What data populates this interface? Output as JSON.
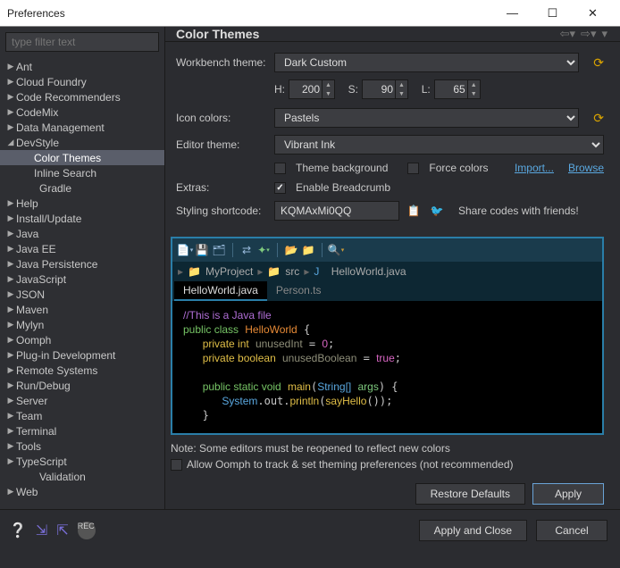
{
  "window": {
    "title": "Preferences"
  },
  "filter": {
    "placeholder": "type filter text"
  },
  "tree": [
    {
      "label": "Ant",
      "caret": "▶"
    },
    {
      "label": "Cloud Foundry",
      "caret": "▶"
    },
    {
      "label": "Code Recommenders",
      "caret": "▶"
    },
    {
      "label": "CodeMix",
      "caret": "▶"
    },
    {
      "label": "Data Management",
      "caret": "▶"
    },
    {
      "label": "DevStyle",
      "caret": "◢",
      "expanded": true,
      "children": [
        {
          "label": "Color Themes",
          "selected": true
        },
        {
          "label": "Inline Search"
        }
      ]
    },
    {
      "label": "Gradle",
      "caret": ""
    },
    {
      "label": "Help",
      "caret": "▶"
    },
    {
      "label": "Install/Update",
      "caret": "▶"
    },
    {
      "label": "Java",
      "caret": "▶"
    },
    {
      "label": "Java EE",
      "caret": "▶"
    },
    {
      "label": "Java Persistence",
      "caret": "▶"
    },
    {
      "label": "JavaScript",
      "caret": "▶"
    },
    {
      "label": "JSON",
      "caret": "▶"
    },
    {
      "label": "Maven",
      "caret": "▶"
    },
    {
      "label": "Mylyn",
      "caret": "▶"
    },
    {
      "label": "Oomph",
      "caret": "▶"
    },
    {
      "label": "Plug-in Development",
      "caret": "▶"
    },
    {
      "label": "Remote Systems",
      "caret": "▶"
    },
    {
      "label": "Run/Debug",
      "caret": "▶"
    },
    {
      "label": "Server",
      "caret": "▶"
    },
    {
      "label": "Team",
      "caret": "▶"
    },
    {
      "label": "Terminal",
      "caret": "▶"
    },
    {
      "label": "Tools",
      "caret": "▶"
    },
    {
      "label": "TypeScript",
      "caret": "▶"
    },
    {
      "label": "Validation",
      "caret": ""
    },
    {
      "label": "Web",
      "caret": "▶"
    }
  ],
  "header": {
    "title": "Color Themes"
  },
  "form": {
    "workbench_label": "Workbench theme:",
    "workbench_value": "Dark Custom",
    "hsl": {
      "h_label": "H:",
      "h": "200",
      "s_label": "S:",
      "s": "90",
      "l_label": "L:",
      "l": "65"
    },
    "icon_label": "Icon colors:",
    "icon_value": "Pastels",
    "editor_label": "Editor theme:",
    "editor_value": "Vibrant Ink",
    "theme_bg": "Theme background",
    "force_colors": "Force colors",
    "import": "Import...",
    "browse": "Browse",
    "extras_label": "Extras:",
    "enable_breadcrumb": "Enable Breadcrumb",
    "shortcode_label": "Styling shortcode:",
    "shortcode_value": "KQMAxMi0QQ",
    "share_text": "Share codes with friends!"
  },
  "preview": {
    "breadcrumb": {
      "project": "MyProject",
      "src": "src",
      "jkind": "J",
      "file": "HelloWorld.java"
    },
    "tabs": [
      "HelloWorld.java",
      "Person.ts"
    ]
  },
  "note": "Note: Some editors must be reopened to reflect new colors",
  "allow": "Allow Oomph to track & set theming preferences (not recommended)",
  "buttons": {
    "restore": "Restore Defaults",
    "apply": "Apply",
    "apply_close": "Apply and Close",
    "cancel": "Cancel"
  }
}
